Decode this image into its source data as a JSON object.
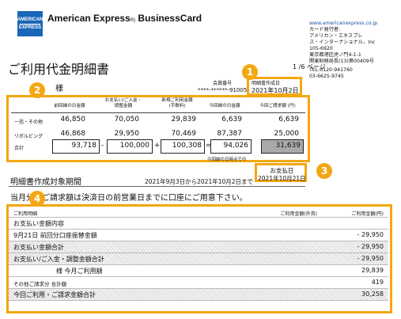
{
  "logo": {
    "line1": "AMERICAN",
    "line2": "EXPRESS"
  },
  "brand": {
    "name": "American Express",
    "reg": "R)",
    "product": "BusinessCard"
  },
  "address": {
    "url": "www.americanexpress.co.jp",
    "lines": [
      "カード発行者:",
      "アメリカン・エキスプレ",
      "ス・インターナショナル，Inc",
      "105-6920",
      "東京都港区虎ノ門4-1-1",
      "関東財務局長(13)第00409号",
      "TEL:0120-941760",
      "03-6625-9745"
    ]
  },
  "title": "ご利用代金明細書",
  "page_label": "1 /6  ページ",
  "markers": [
    "1",
    "2",
    "3",
    "4"
  ],
  "customer": {
    "suffix": "様"
  },
  "member": {
    "label": "会員番号",
    "value": "****-******-91005"
  },
  "issue": {
    "label": "明細書作成日",
    "value": "2021年10月2日"
  },
  "summary": {
    "headers": [
      "前回繰の日金額",
      "お支払い/ご入金・\n調整金額",
      "新規ご利用金額\n(手数料)",
      "今回繰の日金額",
      "今回ご請求額 (円)"
    ],
    "rows": [
      {
        "label": "一括・その他",
        "values": [
          "46,850",
          "70,050",
          "29,839",
          "6,639",
          "6,639"
        ]
      },
      {
        "label": "リボルビング",
        "values": [
          "46,868",
          "29,950",
          "70,469",
          "87,387",
          "25,000"
        ]
      },
      {
        "label": "合計",
        "values": [
          "93,718",
          "100,000",
          "100,308",
          "94,026",
          "31,639"
        ]
      }
    ],
    "ops": [
      "-",
      "+",
      "="
    ],
    "footnote": "今回繰の日時点での"
  },
  "period": {
    "label": "明細書作成対象期間",
    "dates": "2021年9月3日から2021年10月2日まで"
  },
  "payment": {
    "label": "お支払日",
    "date": "2021年10月21日"
  },
  "note": "当月分のご請求額は決済日の前営業日までに口座にご用意下さい。",
  "details": {
    "headers": [
      "ご利用明細",
      "ご利用金額(外貨)",
      "ご利用金額(円)"
    ],
    "rows": [
      {
        "label": "お支払い金額内容",
        "value": "",
        "shade": false
      },
      {
        "label": "9月21日      前回分口座振替金額",
        "value": "- 29,950",
        "shade": false
      },
      {
        "label": "お支払い金額合計",
        "value": "- 29,950",
        "shade": true
      },
      {
        "label": "お支払い/ご入金・調整金額合計",
        "value": "- 29,950",
        "shade": true
      },
      {
        "label": "様   今月ご利用額",
        "value": "29,839",
        "shade": false
      },
      {
        "label": "その他ご請求分  合計額",
        "value": "419",
        "shade": false
      },
      {
        "label": "今回ご利用・ご請求金額合計",
        "value": "30,258",
        "shade": true
      }
    ]
  },
  "colors": {
    "accent": "#f3a712",
    "brand_blue": "#1a66b8",
    "total_fill": "#a9a9a9"
  }
}
